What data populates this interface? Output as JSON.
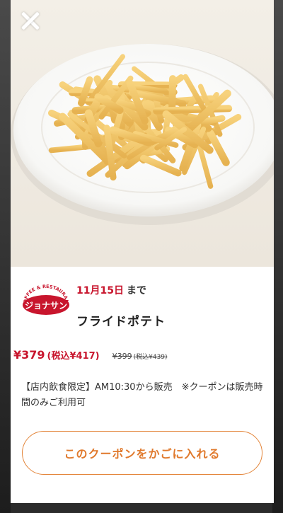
{
  "coupon": {
    "expiry_date": "11月15日",
    "expiry_suffix": "まで",
    "product_name": "フライドポテト",
    "price": "¥379",
    "price_tax": "(税込¥417)",
    "original_price": "¥399",
    "original_price_tax": "(税込¥439)",
    "note": "【店内飲食限定】AM10:30から販売　※クーポンは販売時間のみご利用可",
    "cta_label": "このクーポンをかごに入れる"
  },
  "brand": {
    "logo_text_top": "COFFEE & RESTAURANT",
    "logo_text_main": "ジョナサン"
  },
  "icons": {
    "close": "close-icon",
    "product": "fries-photo"
  },
  "colors": {
    "accent_red": "#c8152d",
    "cta_orange": "#e0792c"
  }
}
